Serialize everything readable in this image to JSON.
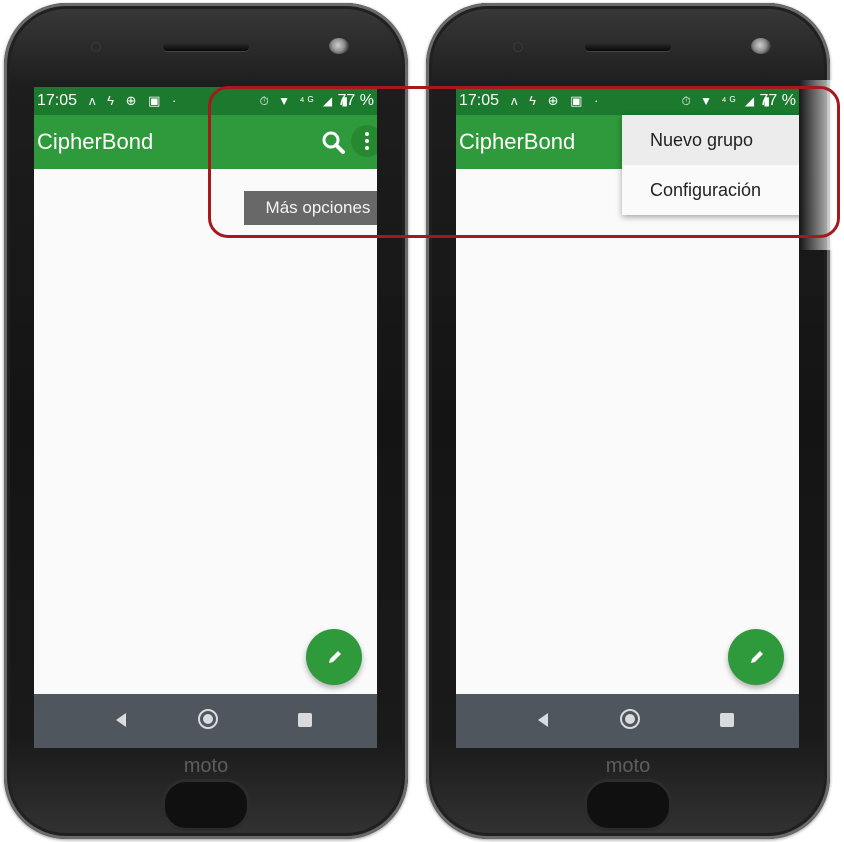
{
  "left_phone": {
    "status_bar": {
      "time": "17:05",
      "notif_icons": "ʌ ϟ ⊕ ▣ ·",
      "sys_icons": "⏱ ▼ ⁴ᴳ ◢ ▮",
      "battery": "77 %"
    },
    "app_bar": {
      "title": "CipherBond",
      "search_icon": "search-icon",
      "overflow_icon": "more-vert-icon"
    },
    "tooltip": "Más opciones",
    "fab_icon": "pencil-icon",
    "brand": "moto"
  },
  "right_phone": {
    "status_bar": {
      "time": "17:05",
      "notif_icons": "ʌ ϟ ⊕ ▣ ·",
      "sys_icons": "⏱ ▼ ⁴ᴳ ◢ ▮",
      "battery": "77 %"
    },
    "app_bar": {
      "title": "CipherBond"
    },
    "menu": {
      "items": [
        "Nuevo grupo",
        "Configuración"
      ]
    },
    "fab_icon": "pencil-icon",
    "brand": "moto"
  },
  "colors": {
    "app_bar": "#2f9a3b",
    "status_bar": "#1b7a2d",
    "nav_bar": "#4f565e",
    "highlight": "#a7181c"
  }
}
